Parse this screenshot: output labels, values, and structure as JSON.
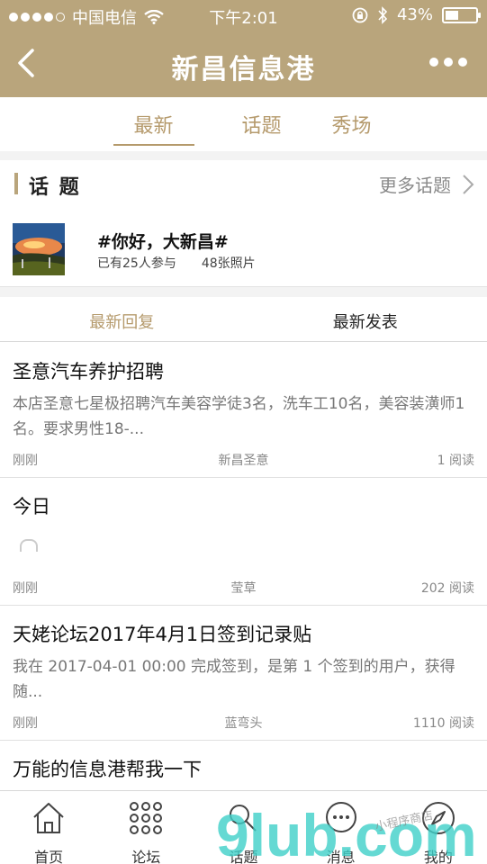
{
  "status": {
    "carrier": "中国电信",
    "time": "下午2:01",
    "battery": "43%",
    "battery_level": 0.43
  },
  "nav": {
    "title": "新昌信息港"
  },
  "tabs": [
    {
      "label": "最新",
      "active": true
    },
    {
      "label": "话题",
      "active": false
    },
    {
      "label": "秀场",
      "active": false
    }
  ],
  "topics_section": {
    "title": "话 题",
    "more_label": "更多话题"
  },
  "topic": {
    "name": "#你好，大新昌#",
    "participants": "已有25人参与",
    "photos": "48张照片"
  },
  "subtabs": {
    "latest_reply": "最新回复",
    "latest_post": "最新发表"
  },
  "posts": [
    {
      "title": "圣意汽车养护招聘",
      "excerpt": "本店圣意七星极招聘汽车美容学徒3名，洗车工10名，美容装潢师1名。要求男性18-...",
      "time": "刚刚",
      "author": "新昌圣意",
      "reads": "1 阅读"
    },
    {
      "title": "今日",
      "excerpt": "",
      "time": "刚刚",
      "author": "莹草",
      "reads": "202 阅读"
    },
    {
      "title": "天姥论坛2017年4月1日签到记录贴",
      "excerpt": "我在 2017-04-01 00:00 完成签到，是第 1 个签到的用户，获得随...",
      "time": "刚刚",
      "author": "蓝弯头",
      "reads": "1110 阅读"
    },
    {
      "title": "万能的信息港帮我一下"
    }
  ],
  "tabbar": [
    {
      "label": "首页",
      "icon": "home-icon"
    },
    {
      "label": "论坛",
      "icon": "grid-icon"
    },
    {
      "label": "话题",
      "icon": "topic-icon"
    },
    {
      "label": "消息",
      "icon": "message-icon"
    },
    {
      "label": "我的",
      "icon": "compass-icon"
    }
  ],
  "colors": {
    "brand": "#b9a57c",
    "accent_text": "#b59a6c"
  },
  "watermark": {
    "text": "9lub.com",
    "small": "小程序商店"
  }
}
